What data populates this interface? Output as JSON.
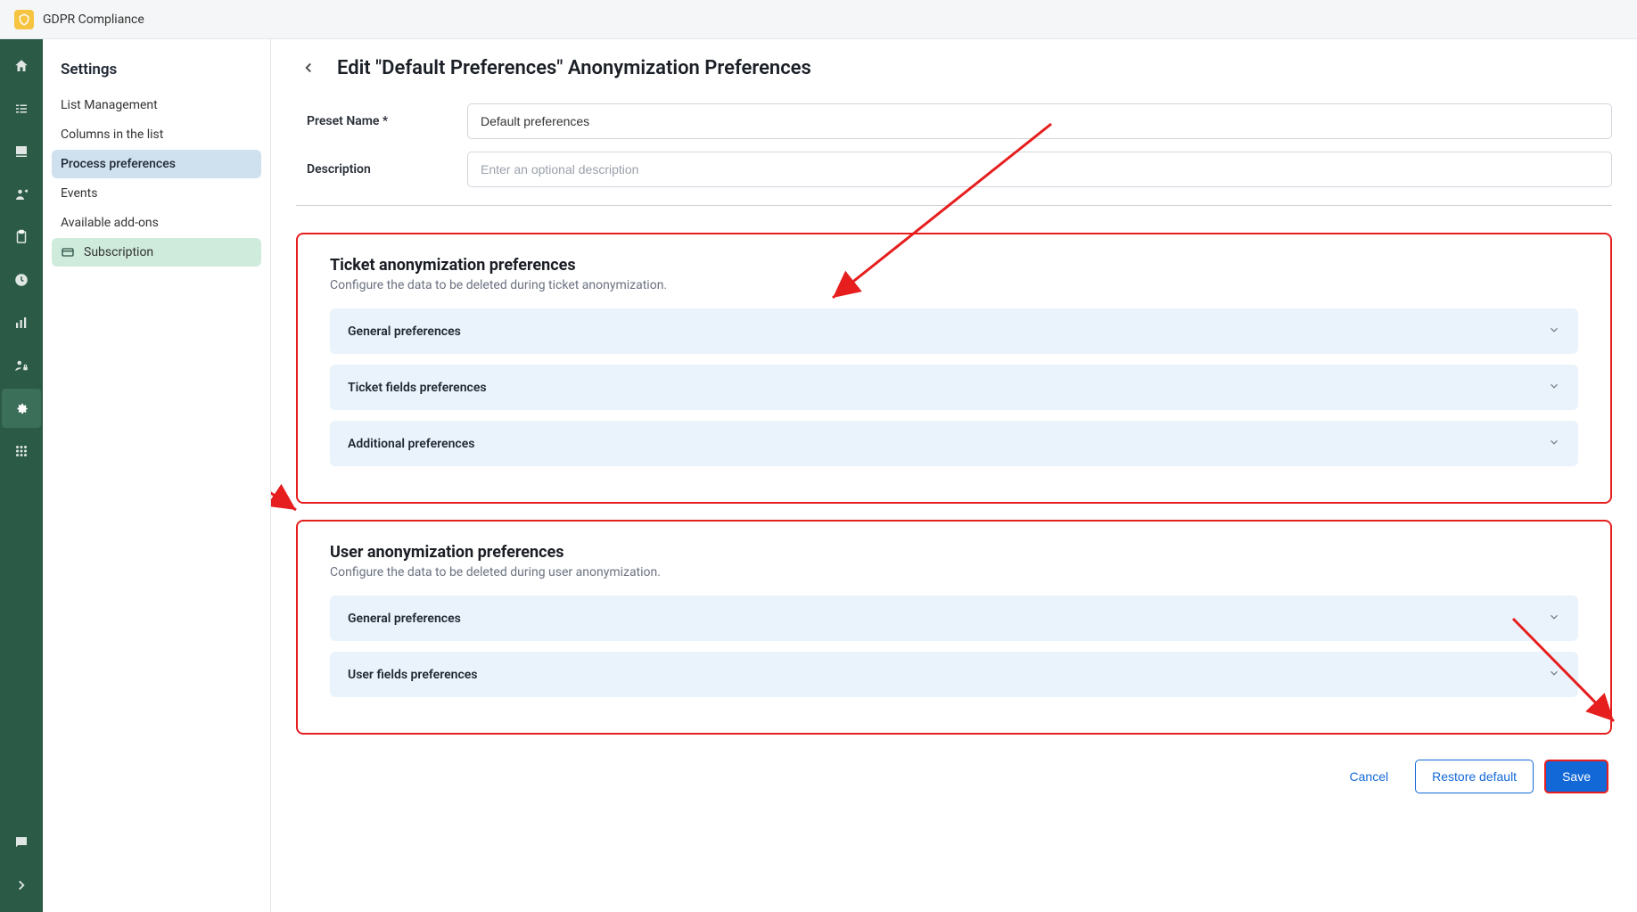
{
  "topbar": {
    "title": "GDPR Compliance"
  },
  "sidebar": {
    "heading": "Settings",
    "items": [
      {
        "label": "List Management"
      },
      {
        "label": "Columns in the list"
      },
      {
        "label": "Process preferences"
      },
      {
        "label": "Events"
      },
      {
        "label": "Available add-ons"
      },
      {
        "label": "Subscription"
      }
    ]
  },
  "page": {
    "title": "Edit \"Default Preferences\" Anonymization Preferences",
    "preset_name_label": "Preset Name *",
    "preset_name_value": "Default preferences",
    "description_label": "Description",
    "description_placeholder": "Enter an optional description"
  },
  "ticket_prefs": {
    "title": "Ticket anonymization preferences",
    "subtitle": "Configure the data to be deleted during ticket anonymization.",
    "accordions": [
      {
        "label": "General preferences"
      },
      {
        "label": "Ticket fields preferences"
      },
      {
        "label": "Additional preferences"
      }
    ]
  },
  "user_prefs": {
    "title": "User anonymization preferences",
    "subtitle": "Configure the data to be deleted during user anonymization.",
    "accordions": [
      {
        "label": "General preferences"
      },
      {
        "label": "User fields preferences"
      }
    ]
  },
  "actions": {
    "cancel": "Cancel",
    "restore": "Restore default",
    "save": "Save"
  }
}
